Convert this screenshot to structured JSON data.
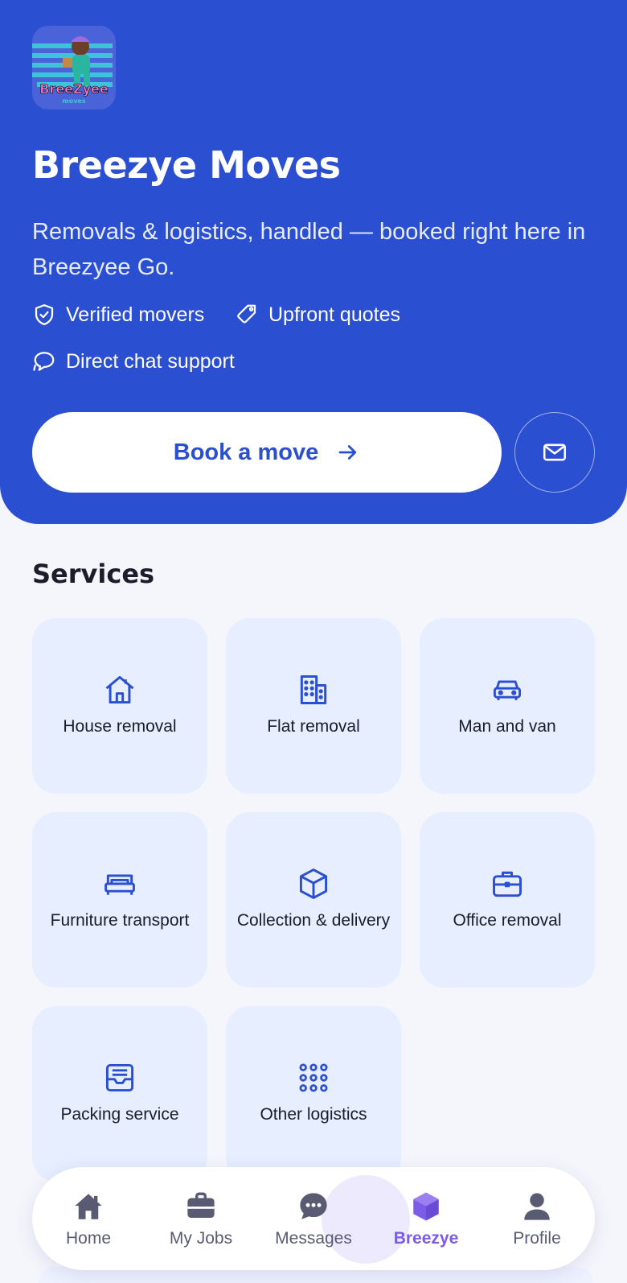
{
  "brand": {
    "title": "Breezye Moves",
    "subtitle": "Removals & logistics, handled — booked right here in Breezyee Go.",
    "logo_text": "BreeZyee",
    "logo_subtext": "moves"
  },
  "features": [
    {
      "icon": "shield-check-icon",
      "label": "Verified movers"
    },
    {
      "icon": "tag-icon",
      "label": "Upfront quotes"
    },
    {
      "icon": "chat-bubbles-icon",
      "label": "Direct chat support"
    }
  ],
  "actions": {
    "book_label": "Book a move",
    "mail_icon": "mail-icon"
  },
  "services": {
    "title": "Services",
    "items": [
      {
        "icon": "house-icon",
        "label": "House removal"
      },
      {
        "icon": "building-icon",
        "label": "Flat removal"
      },
      {
        "icon": "car-icon",
        "label": "Man and van"
      },
      {
        "icon": "bed-icon",
        "label": "Furniture transport"
      },
      {
        "icon": "cube-icon",
        "label": "Collection & delivery"
      },
      {
        "icon": "briefcase-icon",
        "label": "Office removal"
      },
      {
        "icon": "inbox-icon",
        "label": "Packing service"
      },
      {
        "icon": "grid-dots-icon",
        "label": "Other logistics"
      }
    ]
  },
  "nav": {
    "items": [
      {
        "icon": "home-icon",
        "label": "Home",
        "active": false
      },
      {
        "icon": "briefcase-icon",
        "label": "My Jobs",
        "active": false
      },
      {
        "icon": "message-icon",
        "label": "Messages",
        "active": false
      },
      {
        "icon": "cube-icon",
        "label": "Breezye",
        "active": true
      },
      {
        "icon": "person-icon",
        "label": "Profile",
        "active": false
      }
    ]
  },
  "colors": {
    "primary": "#2b4fd1",
    "tile_bg": "#e6eeff",
    "active_nav": "#7b5ce6",
    "page_bg": "#f5f6fc"
  }
}
